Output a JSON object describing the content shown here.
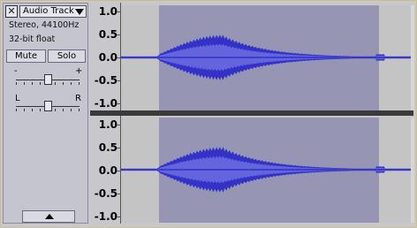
{
  "track": {
    "close_glyph": "✕",
    "name": "Audio Track",
    "format": "Stereo, 44100Hz",
    "sample_format": "32-bit float",
    "mute_label": "Mute",
    "solo_label": "Solo",
    "gain_minus": "-",
    "gain_plus": "+",
    "pan_left": "L",
    "pan_right": "R",
    "gain_level": 0.5,
    "pan_level": 0.5
  },
  "ruler_labels": [
    "1.0",
    "0.5",
    "0.0",
    "-0.5",
    "-1.0"
  ],
  "colors": {
    "waveform": "#3232c8",
    "waveform_rms": "#6464dc",
    "selection": "#9696b4",
    "background": "#c4c4c4"
  },
  "selection": {
    "start_fraction": 0.13,
    "end_fraction": 0.89
  },
  "channels": [
    "left",
    "right"
  ]
}
